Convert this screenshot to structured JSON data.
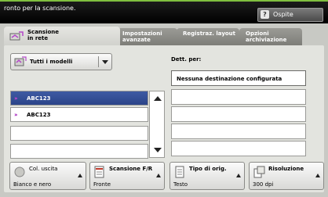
{
  "topbar": {
    "message": "ronto per la scansione.",
    "guest_label": "Ospite"
  },
  "tabs": [
    {
      "label": "Scansione\nin rete"
    },
    {
      "label": "Impostazioni\navanzate"
    },
    {
      "label": "Registraz. layout"
    },
    {
      "label": "Opzioni\narchiviazione"
    }
  ],
  "templates": {
    "dropdown_label": "Tutti i modelli",
    "items": [
      "ABC123",
      "ABC123"
    ]
  },
  "destinations": {
    "header": "Dett. per:",
    "first": "Nessuna destinazione configurata"
  },
  "bottom_buttons": [
    {
      "title": "Col. uscita",
      "value": "Bianco e nero"
    },
    {
      "title": "Scansione F/R",
      "value": "Fronte"
    },
    {
      "title": "Tipo di orig.",
      "value": "Testo"
    },
    {
      "title": "Risoluzione",
      "value": "300 dpi"
    }
  ]
}
